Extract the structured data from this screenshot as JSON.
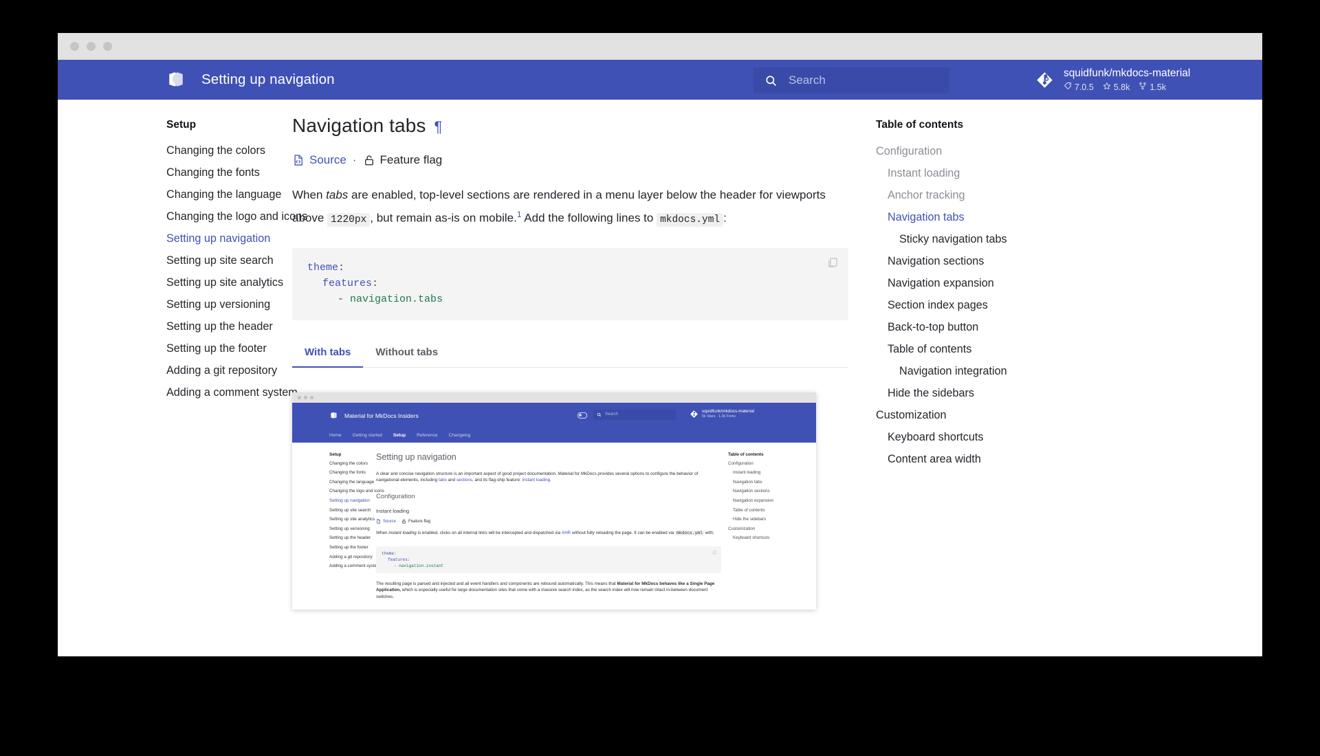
{
  "window": {
    "dots": [
      "close",
      "minimize",
      "maximize"
    ]
  },
  "header": {
    "logo_icon": "mkdocs-material-logo-icon",
    "title": "Setting up navigation",
    "search": {
      "icon": "search-icon",
      "placeholder": "Search",
      "value": ""
    },
    "repo": {
      "icon": "git-repository-icon",
      "name": "squidfunk/mkdocs-material",
      "version": "7.0.5",
      "version_icon": "tag-icon",
      "stars": "5.8k",
      "stars_icon": "star-icon",
      "forks": "1.5k",
      "forks_icon": "fork-icon"
    }
  },
  "sidebar": {
    "title": "Setup",
    "items": [
      {
        "label": "Changing the colors",
        "active": false
      },
      {
        "label": "Changing the fonts",
        "active": false
      },
      {
        "label": "Changing the language",
        "active": false
      },
      {
        "label": "Changing the logo and icons",
        "active": false
      },
      {
        "label": "Setting up navigation",
        "active": true
      },
      {
        "label": "Setting up site search",
        "active": false
      },
      {
        "label": "Setting up site analytics",
        "active": false
      },
      {
        "label": "Setting up versioning",
        "active": false
      },
      {
        "label": "Setting up the header",
        "active": false
      },
      {
        "label": "Setting up the footer",
        "active": false
      },
      {
        "label": "Adding a git repository",
        "active": false
      },
      {
        "label": "Adding a comment system",
        "active": false
      }
    ]
  },
  "main": {
    "heading": "Navigation tabs",
    "permalink_symbol": "¶",
    "meta": {
      "source_icon": "file-code-icon",
      "source_label": "Source",
      "separator": "·",
      "flag_icon": "unlock-icon",
      "flag_label": "Feature flag"
    },
    "paragraph": {
      "part1": "When ",
      "em1": "tabs",
      "part2": " are enabled, top-level sections are rendered in a menu layer below the header for viewports above ",
      "code1": "1220px",
      "part3": ", but remain as-is on mobile.",
      "footnote": "1",
      "part4": " Add the following lines to ",
      "code2": "mkdocs.yml",
      "part5": ":"
    },
    "code_block": {
      "copy_icon": "copy-icon",
      "line1_key": "theme",
      "line1_punc": ":",
      "line2_key": "features",
      "line2_punc": ":",
      "line3_dash": "- ",
      "line3_val": "navigation.tabs"
    },
    "tabs": [
      {
        "label": "With tabs",
        "active": true
      },
      {
        "label": "Without tabs",
        "active": false
      }
    ]
  },
  "screenshot": {
    "titlebar_dots": [
      "close",
      "minimize",
      "maximize"
    ],
    "header": {
      "logo_icon": "mkdocs-material-logo-icon",
      "title": "Material for MkDocs Insiders",
      "toggle_icon": "theme-toggle-icon",
      "search_icon": "search-icon",
      "search_placeholder": "Search",
      "repo_icon": "git-repository-icon",
      "repo_name": "squidfunk/mkdocs-material",
      "repo_facts": "5k Stars · 1.3k Forks"
    },
    "nav_tabs": [
      {
        "label": "Home",
        "active": false
      },
      {
        "label": "Getting started",
        "active": false
      },
      {
        "label": "Setup",
        "active": true
      },
      {
        "label": "Reference",
        "active": false
      },
      {
        "label": "Changelog",
        "active": false
      }
    ],
    "sidebar": {
      "title": "Setup",
      "items": [
        {
          "label": "Changing the colors",
          "active": false
        },
        {
          "label": "Changing the fonts",
          "active": false
        },
        {
          "label": "Changing the language",
          "active": false
        },
        {
          "label": "Changing the logo and icons",
          "active": false
        },
        {
          "label": "Setting up navigation",
          "active": true
        },
        {
          "label": "Setting up site search",
          "active": false
        },
        {
          "label": "Setting up site analytics",
          "active": false
        },
        {
          "label": "Setting up versioning",
          "active": false
        },
        {
          "label": "Setting up the header",
          "active": false
        },
        {
          "label": "Setting up the footer",
          "active": false
        },
        {
          "label": "Adding a git repository",
          "active": false
        },
        {
          "label": "Adding a comment system",
          "active": false
        }
      ]
    },
    "content": {
      "h1": "Setting up navigation",
      "intro_1": "A clear and concise navigation structure is an important aspect of good project documentation. Material for MkDocs provides several options to configure the behavior of navigational elements, including ",
      "intro_link1": "tabs",
      "intro_2": " and ",
      "intro_link2": "sections",
      "intro_3": ", and its flag-ship feature: ",
      "intro_link3": "instant loading",
      "intro_4": ".",
      "h2": "Configuration",
      "h3": "Instant loading",
      "meta_source": "Source",
      "meta_sep": "·",
      "meta_flag": "Feature flag",
      "para2_1": "When ",
      "para2_em": "instant loading",
      "para2_2": " is enabled, clicks on all internal links will be intercepted and dispatched via ",
      "para2_link": "XHR",
      "para2_3": " without fully reloading the page. It can be enabled via ",
      "para2_code": "mkdocs.yml",
      "para2_4": " with:",
      "code_line1": "theme:",
      "code_line2": "features:",
      "code_line3": "- navigation.instant",
      "para3_1": "The resulting page is parsed and injected and all event handlers and components are rebound automatically. This means that ",
      "para3_bold": "Material for MkDocs behaves like a Single Page Application,",
      "para3_2": " which is especially useful for large documentation sites that come with a massive search index, as the search index will now remain intact in-between document switches."
    },
    "toc": {
      "title": "Table of contents",
      "items": [
        {
          "label": "Configuration",
          "level": 1
        },
        {
          "label": "Instant loading",
          "level": 2
        },
        {
          "label": "Navigation tabs",
          "level": 2
        },
        {
          "label": "Navigation sections",
          "level": 2
        },
        {
          "label": "Navigation expansion",
          "level": 2
        },
        {
          "label": "Table of contents",
          "level": 2
        },
        {
          "label": "Hide the sidebars",
          "level": 2
        },
        {
          "label": "Customization",
          "level": 1
        },
        {
          "label": "Keyboard shortcuts",
          "level": 2
        }
      ]
    }
  },
  "toc": {
    "title": "Table of contents",
    "items": [
      {
        "label": "Configuration",
        "level": 1,
        "state": "muted"
      },
      {
        "label": "Instant loading",
        "level": 2,
        "state": "muted"
      },
      {
        "label": "Anchor tracking",
        "level": 2,
        "state": "muted"
      },
      {
        "label": "Navigation tabs",
        "level": 2,
        "state": "active"
      },
      {
        "label": "Sticky navigation tabs",
        "level": 3,
        "state": "dark"
      },
      {
        "label": "Navigation sections",
        "level": 2,
        "state": "dark"
      },
      {
        "label": "Navigation expansion",
        "level": 2,
        "state": "dark"
      },
      {
        "label": "Section index pages",
        "level": 2,
        "state": "dark"
      },
      {
        "label": "Back-to-top button",
        "level": 2,
        "state": "dark"
      },
      {
        "label": "Table of contents",
        "level": 2,
        "state": "dark"
      },
      {
        "label": "Navigation integration",
        "level": 3,
        "state": "dark"
      },
      {
        "label": "Hide the sidebars",
        "level": 2,
        "state": "dark"
      },
      {
        "label": "Customization",
        "level": 1,
        "state": "dark"
      },
      {
        "label": "Keyboard shortcuts",
        "level": 2,
        "state": "dark"
      },
      {
        "label": "Content area width",
        "level": 2,
        "state": "dark"
      }
    ]
  },
  "colors": {
    "primary": "#4051b5",
    "search_bg": "#3a4aa8",
    "code_bg": "#f4f4f4",
    "muted": "#8b8e95",
    "text": "#23262c",
    "yaml_key": "#4051b5",
    "yaml_value": "#1d7a4d"
  }
}
